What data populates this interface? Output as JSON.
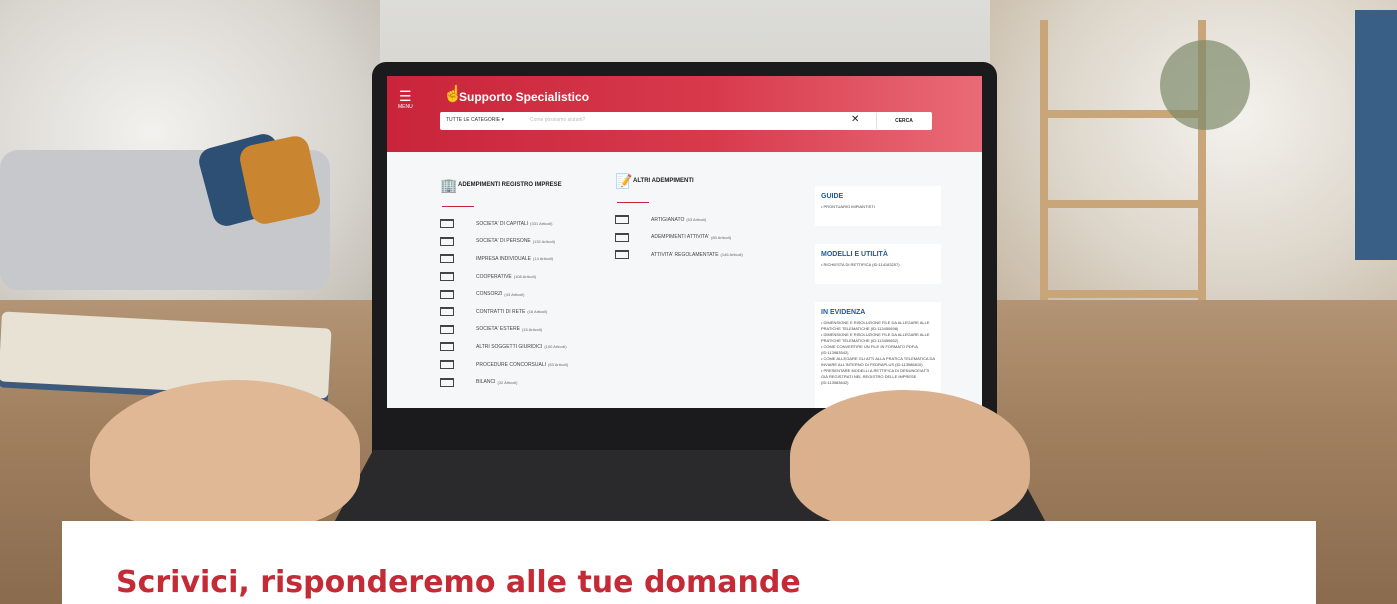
{
  "screen_app": {
    "menu_label": "MENU",
    "title": "Supporto Specialistico",
    "category_select": "TUTTE LE CATEGORIE",
    "search_placeholder": "Come possiamo aiutarti?",
    "search_button": "CERCA",
    "clear_icon": "close-icon"
  },
  "registro": {
    "heading": "ADEMPIMENTI REGISTRO IMPRESE",
    "items": [
      {
        "label": "SOCIETA' DI CAPITALI",
        "count": "(331 Articoli)"
      },
      {
        "label": "SOCIETA' DI PERSONE",
        "count": "(132 Articoli)"
      },
      {
        "label": "IMPRESA INDIVIDUALE",
        "count": "(14 Articoli)"
      },
      {
        "label": "COOPERATIVE",
        "count": "(108 Articoli)"
      },
      {
        "label": "CONSORZI",
        "count": "(43 Articoli)"
      },
      {
        "label": "CONTRATTI DI RETE",
        "count": "(16 Articoli)"
      },
      {
        "label": "SOCIETA' ESTERE",
        "count": "(15 Articoli)"
      },
      {
        "label": "ALTRI SOGGETTI GIURIDICI",
        "count": "(100 Articoli)"
      },
      {
        "label": "PROCEDURE CONCORSUALI",
        "count": "(83 Articoli)"
      },
      {
        "label": "BILANCI",
        "count": "(32 Articoli)"
      }
    ]
  },
  "altri": {
    "heading": "ALTRI ADEMPIMENTI",
    "items": [
      {
        "label": "ARTIGIANATO",
        "count": "(53 Articoli)"
      },
      {
        "label": "ADEMPIMENTI ATTIVITA'",
        "count": "(89 Articoli)"
      },
      {
        "label": "ATTIVITA' REGOLAMENTATE",
        "count": "(146 Articoli)"
      }
    ]
  },
  "guide": {
    "heading": "GUIDE",
    "items": [
      "PRONTUARIO IMPIANTISTI"
    ]
  },
  "modelli": {
    "heading": "MODELLI E UTILITÀ",
    "items": [
      "RICHIESTA DI RETTIFICA (ID:114183207)"
    ]
  },
  "evidenza": {
    "heading": "IN EVIDENZA",
    "items": [
      "DIMENSIONE E RISOLUZIONE FILE DA ALLEGARE ALLE PRATICHE TELEMATICHE (ID:113450698)",
      "DIMENSIONE E RISOLUZIONE FILE DA ALLEGARE ALLE PRATICHE TELEMATICHE (ID:113450652)",
      "COME CONVERTIRE UN FILE IN FORMATO PDF/A (ID:113983542)",
      "COME ALLEGARE GLI ATTI ALLA PRATICA TELEMATICA DA INVIARE ALL'INTERNO DI FEDRAPLUS (ID:113986810)",
      "PRESENTARE MODELLI A RETTIFICA DI DENUNCE/ATTI GIÀ REGISTRATI NEL REGISTRO DELLE IMPRESE (ID:113983642)"
    ]
  },
  "page": {
    "heading": "Scrivici, risponderemo alle tue domande"
  }
}
